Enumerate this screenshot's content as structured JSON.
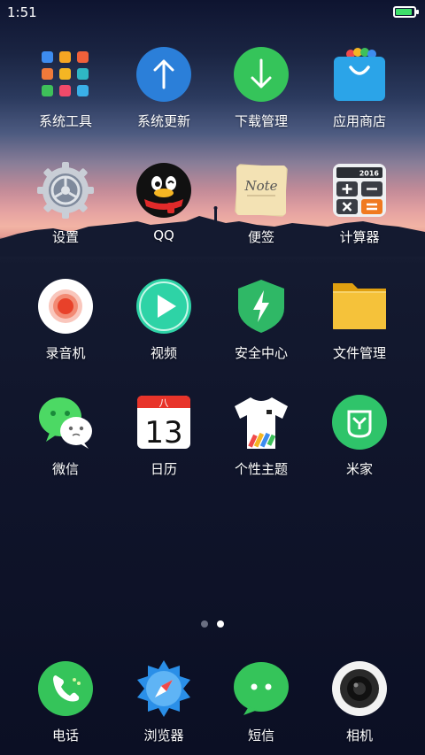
{
  "status": {
    "time": "1:51",
    "battery_level": 0.9,
    "battery_color": "#3ee06a"
  },
  "rows": [
    [
      {
        "label": "系统工具",
        "icon": "folder-tools-icon"
      },
      {
        "label": "系统更新",
        "icon": "update-arrow-icon"
      },
      {
        "label": "下载管理",
        "icon": "download-icon"
      },
      {
        "label": "应用商店",
        "icon": "app-store-bag-icon"
      }
    ],
    [
      {
        "label": "设置",
        "icon": "gear-icon"
      },
      {
        "label": "QQ",
        "icon": "qq-penguin-icon"
      },
      {
        "label": "便签",
        "icon": "note-icon"
      },
      {
        "label": "计算器",
        "icon": "calculator-icon"
      }
    ],
    [
      {
        "label": "录音机",
        "icon": "recorder-icon"
      },
      {
        "label": "视频",
        "icon": "video-play-icon"
      },
      {
        "label": "安全中心",
        "icon": "shield-bolt-icon"
      },
      {
        "label": "文件管理",
        "icon": "folder-icon"
      }
    ],
    [
      {
        "label": "微信",
        "icon": "wechat-icon"
      },
      {
        "label": "日历",
        "icon": "calendar-icon"
      },
      {
        "label": "个性主题",
        "icon": "tshirt-icon"
      },
      {
        "label": "米家",
        "icon": "mijia-icon"
      }
    ]
  ],
  "dock": [
    {
      "label": "电话",
      "icon": "phone-icon"
    },
    {
      "label": "浏览器",
      "icon": "compass-icon"
    },
    {
      "label": "短信",
      "icon": "message-icon"
    },
    {
      "label": "相机",
      "icon": "camera-icon"
    }
  ],
  "icon_text": {
    "note": "Note",
    "calc_year": "2016",
    "calendar_month": "八",
    "calendar_day": "13"
  },
  "pager": {
    "count": 2,
    "active": 1
  }
}
